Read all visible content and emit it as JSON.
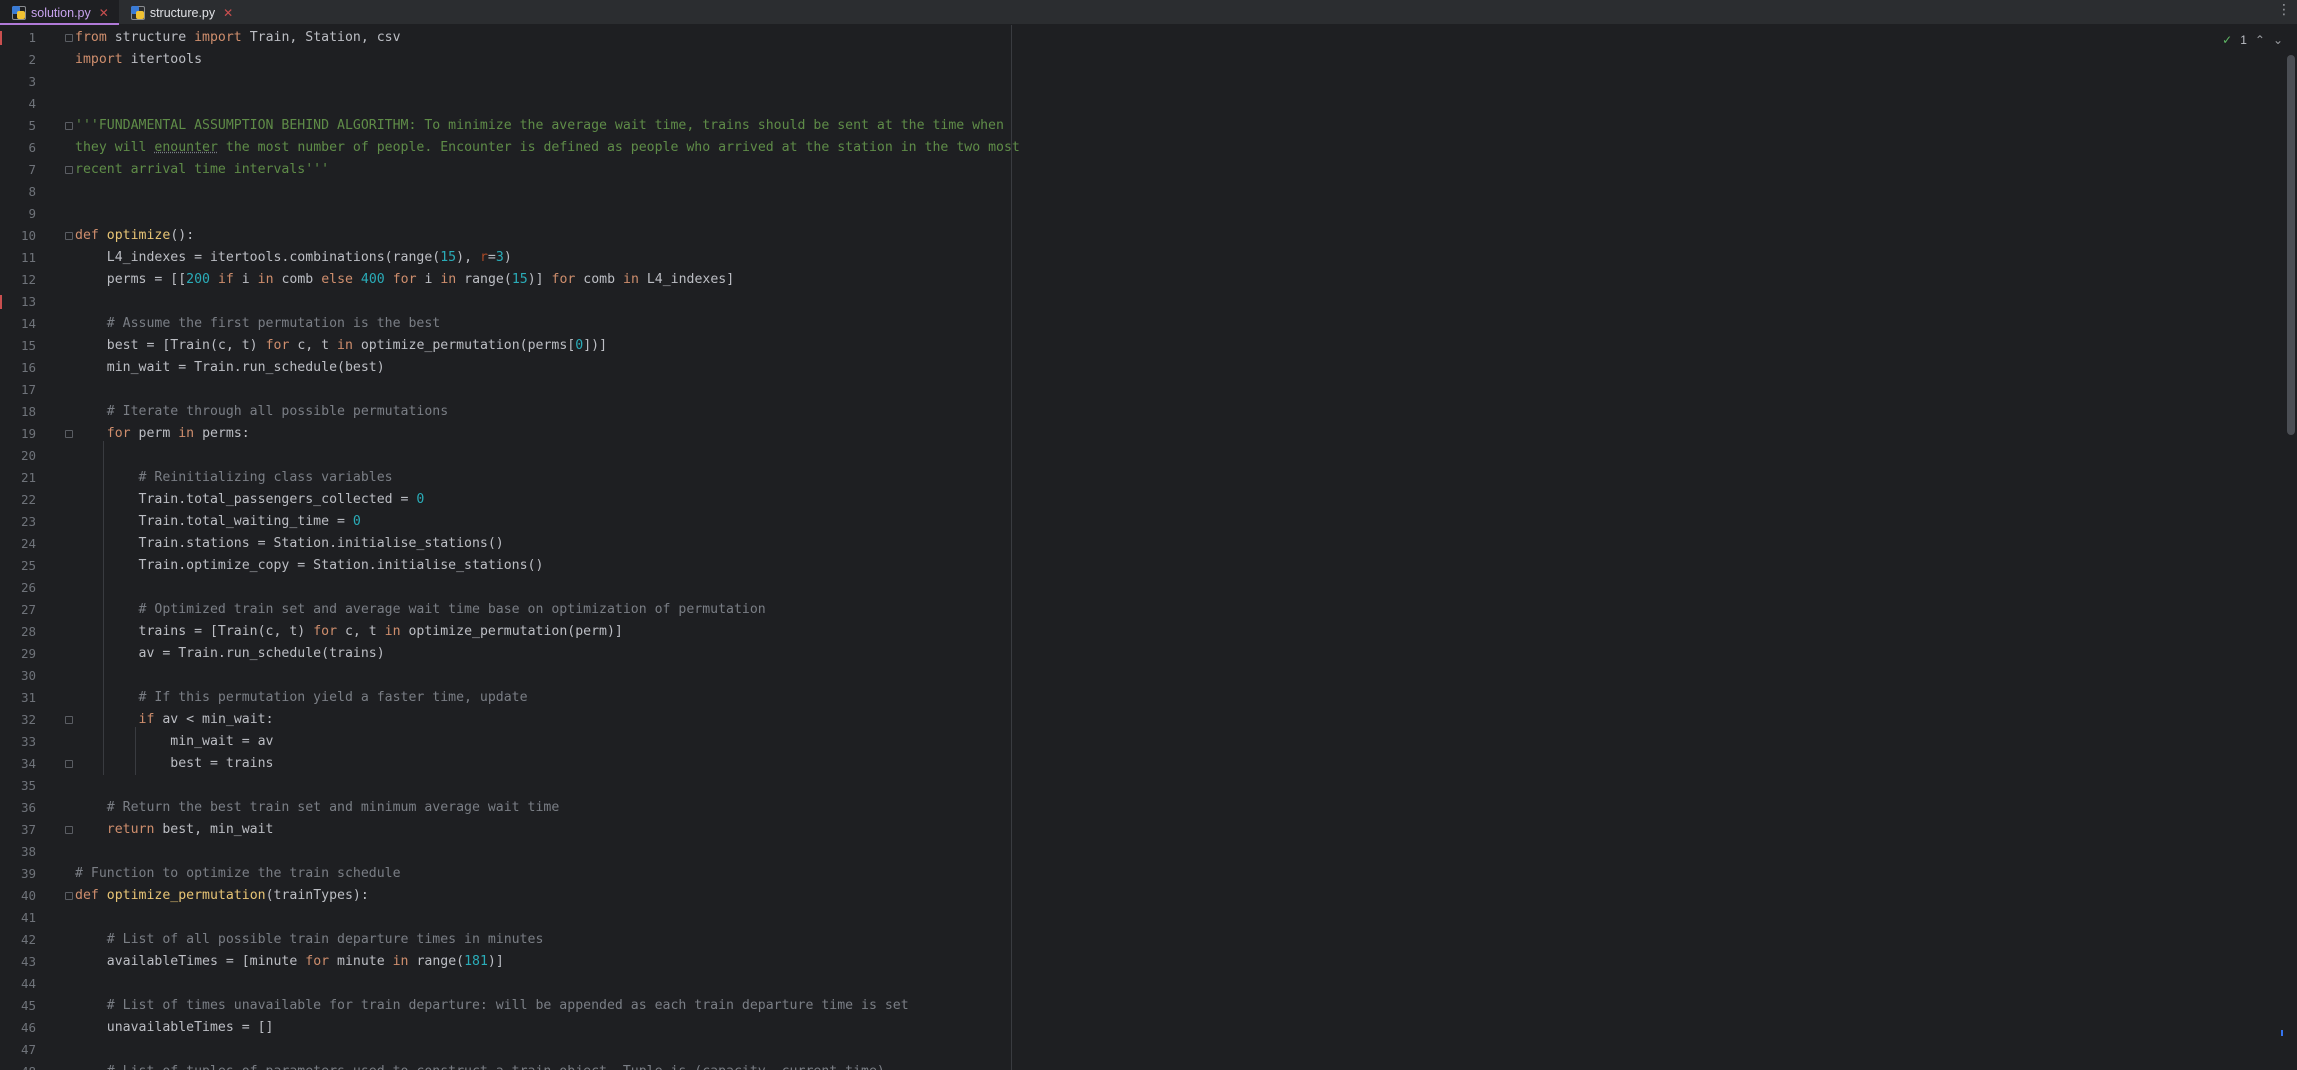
{
  "tabs": [
    {
      "label": "solution.py",
      "close": "✕",
      "active": true
    },
    {
      "label": "structure.py",
      "close": "✕",
      "active": false
    }
  ],
  "inspection": {
    "ok_icon": "✓",
    "count": "1",
    "up": "⌃",
    "down": "⌄"
  },
  "menu_icon": "⋮",
  "code": [
    [
      [
        "kw",
        "from"
      ],
      [
        "p",
        " structure "
      ],
      [
        "kw",
        "import"
      ],
      [
        "p",
        " Train, Station, csv"
      ]
    ],
    [
      [
        "kw",
        "import"
      ],
      [
        "p",
        " itertools"
      ]
    ],
    [],
    [],
    [
      [
        "doc",
        "'''FUNDAMENTAL ASSUMPTION BEHIND ALGORITHM: To minimize the average wait time, trains should be sent at the time when"
      ]
    ],
    [
      [
        "doc",
        "they will "
      ],
      [
        "doctypo",
        "enounter"
      ],
      [
        "doc",
        " the most number of people. Encounter is defined as people who arrived at the station in the two most"
      ]
    ],
    [
      [
        "doc",
        "recent arrival time intervals'''"
      ]
    ],
    [],
    [],
    [
      [
        "kw",
        "def"
      ],
      [
        "p",
        " "
      ],
      [
        "fn",
        "optimize"
      ],
      [
        "p",
        "():"
      ]
    ],
    [
      [
        "p",
        "    L4_indexes = itertools.combinations(range("
      ],
      [
        "num",
        "15"
      ],
      [
        "p",
        "), "
      ],
      [
        "kwarg",
        "r"
      ],
      [
        "p",
        "="
      ],
      [
        "num",
        "3"
      ],
      [
        "p",
        ")"
      ]
    ],
    [
      [
        "p",
        "    perms = [["
      ],
      [
        "num",
        "200"
      ],
      [
        "p",
        " "
      ],
      [
        "kw",
        "if"
      ],
      [
        "p",
        " i "
      ],
      [
        "kw",
        "in"
      ],
      [
        "p",
        " comb "
      ],
      [
        "kw",
        "else"
      ],
      [
        "p",
        " "
      ],
      [
        "num",
        "400"
      ],
      [
        "p",
        " "
      ],
      [
        "kw",
        "for"
      ],
      [
        "p",
        " i "
      ],
      [
        "kw",
        "in"
      ],
      [
        "p",
        " range("
      ],
      [
        "num",
        "15"
      ],
      [
        "p",
        ")] "
      ],
      [
        "kw",
        "for"
      ],
      [
        "p",
        " comb "
      ],
      [
        "kw",
        "in"
      ],
      [
        "p",
        " L4_indexes]"
      ]
    ],
    [],
    [
      [
        "cmt",
        "    # Assume the first permutation is the best"
      ]
    ],
    [
      [
        "p",
        "    best = [Train(c, t) "
      ],
      [
        "kw",
        "for"
      ],
      [
        "p",
        " c, t "
      ],
      [
        "kw",
        "in"
      ],
      [
        "p",
        " optimize_permutation(perms["
      ],
      [
        "num",
        "0"
      ],
      [
        "p",
        "])]"
      ]
    ],
    [
      [
        "p",
        "    min_wait = Train.run_schedule(best)"
      ]
    ],
    [],
    [
      [
        "cmt",
        "    # Iterate through all possible permutations"
      ]
    ],
    [
      [
        "p",
        "    "
      ],
      [
        "kw",
        "for"
      ],
      [
        "p",
        " perm "
      ],
      [
        "kw",
        "in"
      ],
      [
        "p",
        " perms:"
      ]
    ],
    [],
    [
      [
        "cmt",
        "        # Reinitializing class variables"
      ]
    ],
    [
      [
        "p",
        "        Train.total_passengers_collected = "
      ],
      [
        "num",
        "0"
      ]
    ],
    [
      [
        "p",
        "        Train.total_waiting_time = "
      ],
      [
        "num",
        "0"
      ]
    ],
    [
      [
        "p",
        "        Train.stations = Station.initialise_stations()"
      ]
    ],
    [
      [
        "p",
        "        Train.optimize_copy = Station.initialise_stations()"
      ]
    ],
    [],
    [
      [
        "cmt",
        "        # Optimized train set and average wait time base on optimization of permutation"
      ]
    ],
    [
      [
        "p",
        "        trains = [Train(c, t) "
      ],
      [
        "kw",
        "for"
      ],
      [
        "p",
        " c, t "
      ],
      [
        "kw",
        "in"
      ],
      [
        "p",
        " optimize_permutation(perm)]"
      ]
    ],
    [
      [
        "p",
        "        av = Train.run_schedule(trains)"
      ]
    ],
    [],
    [
      [
        "cmt",
        "        # If this permutation yield a faster time, update"
      ]
    ],
    [
      [
        "p",
        "        "
      ],
      [
        "kw",
        "if"
      ],
      [
        "p",
        " av < min_wait:"
      ]
    ],
    [
      [
        "p",
        "            min_wait = av"
      ]
    ],
    [
      [
        "p",
        "            best = trains"
      ]
    ],
    [],
    [
      [
        "cmt",
        "    # Return the best train set and minimum average wait time"
      ]
    ],
    [
      [
        "p",
        "    "
      ],
      [
        "kw",
        "return"
      ],
      [
        "p",
        " best, min_wait"
      ]
    ],
    [],
    [
      [
        "cmt",
        "# Function to optimize the train schedule"
      ]
    ],
    [
      [
        "kw",
        "def"
      ],
      [
        "p",
        " "
      ],
      [
        "fn",
        "optimize_permutation"
      ],
      [
        "p",
        "(trainTypes):"
      ]
    ],
    [],
    [
      [
        "cmt",
        "    # List of all possible train departure times in minutes"
      ]
    ],
    [
      [
        "p",
        "    availableTimes = [minute "
      ],
      [
        "kw",
        "for"
      ],
      [
        "p",
        " minute "
      ],
      [
        "kw",
        "in"
      ],
      [
        "p",
        " range("
      ],
      [
        "num",
        "181"
      ],
      [
        "p",
        ")]"
      ]
    ],
    [],
    [
      [
        "cmt",
        "    # List of times unavailable for train departure: will be appended as each train departure time is set"
      ]
    ],
    [
      [
        "p",
        "    unavailableTimes = []"
      ]
    ],
    [],
    [
      [
        "cmt",
        "    # List of tuples of parameters used to construct a train object. Tuple is (capacity, current time)"
      ]
    ]
  ]
}
